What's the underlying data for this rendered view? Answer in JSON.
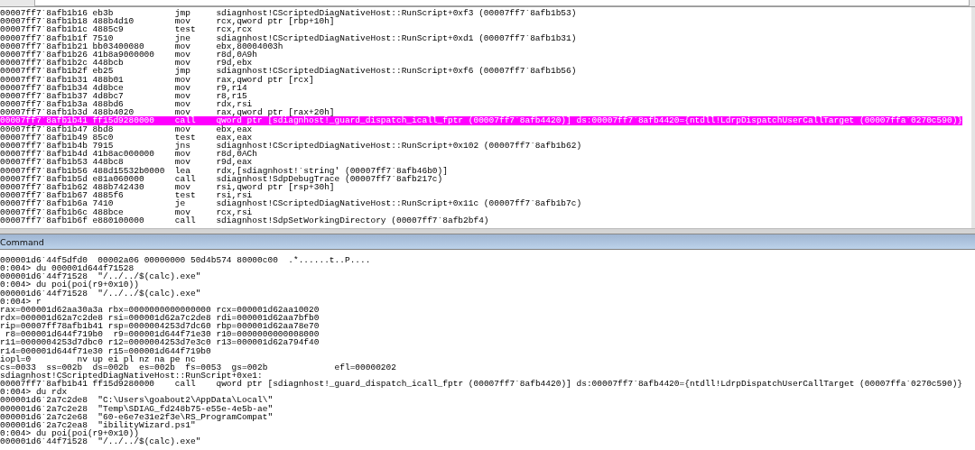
{
  "disassembly": {
    "rows": [
      {
        "address": "00007ff7`8afb1b16",
        "bytes": "eb3b",
        "mnemonic": "jmp",
        "operands": "sdiagnhost!CScriptedDiagNativeHost::RunScript+0xf3 (00007ff7`8afb1b53)",
        "selected": false
      },
      {
        "address": "00007ff7`8afb1b18",
        "bytes": "488b4d10",
        "mnemonic": "mov",
        "operands": "rcx,qword ptr [rbp+10h]",
        "selected": false
      },
      {
        "address": "00007ff7`8afb1b1c",
        "bytes": "4885c9",
        "mnemonic": "test",
        "operands": "rcx,rcx",
        "selected": false
      },
      {
        "address": "00007ff7`8afb1b1f",
        "bytes": "7510",
        "mnemonic": "jne",
        "operands": "sdiagnhost!CScriptedDiagNativeHost::RunScript+0xd1 (00007ff7`8afb1b31)",
        "selected": false
      },
      {
        "address": "00007ff7`8afb1b21",
        "bytes": "bb03400080",
        "mnemonic": "mov",
        "operands": "ebx,80004003h",
        "selected": false
      },
      {
        "address": "00007ff7`8afb1b26",
        "bytes": "41b8a9000000",
        "mnemonic": "mov",
        "operands": "r8d,0A9h",
        "selected": false
      },
      {
        "address": "00007ff7`8afb1b2c",
        "bytes": "448bcb",
        "mnemonic": "mov",
        "operands": "r9d,ebx",
        "selected": false
      },
      {
        "address": "00007ff7`8afb1b2f",
        "bytes": "eb25",
        "mnemonic": "jmp",
        "operands": "sdiagnhost!CScriptedDiagNativeHost::RunScript+0xf6 (00007ff7`8afb1b56)",
        "selected": false
      },
      {
        "address": "00007ff7`8afb1b31",
        "bytes": "488b01",
        "mnemonic": "mov",
        "operands": "rax,qword ptr [rcx]",
        "selected": false
      },
      {
        "address": "00007ff7`8afb1b34",
        "bytes": "4d8bce",
        "mnemonic": "mov",
        "operands": "r9,r14",
        "selected": false
      },
      {
        "address": "00007ff7`8afb1b37",
        "bytes": "4d8bc7",
        "mnemonic": "mov",
        "operands": "r8,r15",
        "selected": false
      },
      {
        "address": "00007ff7`8afb1b3a",
        "bytes": "488bd6",
        "mnemonic": "mov",
        "operands": "rdx,rsi",
        "selected": false
      },
      {
        "address": "00007ff7`8afb1b3d",
        "bytes": "488b4020",
        "mnemonic": "mov",
        "operands": "rax,qword ptr [rax+20h]",
        "selected": false
      },
      {
        "address": "00007ff7`8afb1b41",
        "bytes": "ff15d9280000",
        "mnemonic": "call",
        "operands": "qword ptr [sdiagnhost!_guard_dispatch_icall_fptr (00007ff7`8afb4420)] ds:00007ff7`8afb4420={ntdll!LdrpDispatchUserCallTarget (00007ffa`0270c590)}",
        "selected": true
      },
      {
        "address": "00007ff7`8afb1b47",
        "bytes": "8bd8",
        "mnemonic": "mov",
        "operands": "ebx,eax",
        "selected": false
      },
      {
        "address": "00007ff7`8afb1b49",
        "bytes": "85c0",
        "mnemonic": "test",
        "operands": "eax,eax",
        "selected": false
      },
      {
        "address": "00007ff7`8afb1b4b",
        "bytes": "7915",
        "mnemonic": "jns",
        "operands": "sdiagnhost!CScriptedDiagNativeHost::RunScript+0x102 (00007ff7`8afb1b62)",
        "selected": false
      },
      {
        "address": "00007ff7`8afb1b4d",
        "bytes": "41b8ac000000",
        "mnemonic": "mov",
        "operands": "r8d,0ACh",
        "selected": false
      },
      {
        "address": "00007ff7`8afb1b53",
        "bytes": "448bc8",
        "mnemonic": "mov",
        "operands": "r9d,eax",
        "selected": false
      },
      {
        "address": "00007ff7`8afb1b56",
        "bytes": "488d15532b0000",
        "mnemonic": "lea",
        "operands": "rdx,[sdiagnhost!`string' (00007ff7`8afb46b0)]",
        "selected": false
      },
      {
        "address": "00007ff7`8afb1b5d",
        "bytes": "e81a060000",
        "mnemonic": "call",
        "operands": "sdiagnhost!SdpDebugTrace (00007ff7`8afb217c)",
        "selected": false
      },
      {
        "address": "00007ff7`8afb1b62",
        "bytes": "488b742430",
        "mnemonic": "mov",
        "operands": "rsi,qword ptr [rsp+30h]",
        "selected": false
      },
      {
        "address": "00007ff7`8afb1b67",
        "bytes": "4885f6",
        "mnemonic": "test",
        "operands": "rsi,rsi",
        "selected": false
      },
      {
        "address": "00007ff7`8afb1b6a",
        "bytes": "7410",
        "mnemonic": "je",
        "operands": "sdiagnhost!CScriptedDiagNativeHost::RunScript+0x11c (00007ff7`8afb1b7c)",
        "selected": false
      },
      {
        "address": "00007ff7`8afb1b6c",
        "bytes": "488bce",
        "mnemonic": "mov",
        "operands": "rcx,rsi",
        "selected": false
      },
      {
        "address": "00007ff7`8afb1b6f",
        "bytes": "e880100000",
        "mnemonic": "call",
        "operands": "sdiagnhost!SdpSetWorkingDirectory (00007ff7`8afb2bf4)",
        "selected": false
      }
    ]
  },
  "command": {
    "title": "Command",
    "lines": [
      "000001d6`44f5dfd0  00002a06 00000000 50d4b574 80000c00  .*......t..P....",
      "0:004> du 000001d644f71528",
      "000001d6`44f71528  \"/../../$(calc).exe\"",
      "0:004> du poi(poi(r9+0x10))",
      "000001d6`44f71528  \"/../../$(calc).exe\"",
      "0:004> r",
      "rax=000001d62aa30a3a rbx=0000000000000000 rcx=000001d62aa10020",
      "rdx=000001d62a7c2de8 rsi=000001d62a7c2de8 rdi=000001d62aa7bfb0",
      "rip=00007ff78afb1b41 rsp=0000004253d7dc60 rbp=000001d62aa78e70",
      " r8=000001d644f719b0  r9=000001d644f71e30 r10=0000000000008000",
      "r11=0000004253d7dbc0 r12=0000004253d7e3c0 r13=000001d62a794f40",
      "r14=000001d644f71e30 r15=000001d644f719b0",
      "iopl=0         nv up ei pl nz na pe nc",
      "cs=0033  ss=002b  ds=002b  es=002b  fs=0053  gs=002b             efl=00000202",
      "sdiagnhost!CScriptedDiagNativeHost::RunScript+0xe1:",
      "00007ff7`8afb1b41 ff15d9280000    call    qword ptr [sdiagnhost!_guard_dispatch_icall_fptr (00007ff7`8afb4420)] ds:00007ff7`8afb4420={ntdll!LdrpDispatchUserCallTarget (00007ffa`0270c590)}",
      "0:004> du rdx",
      "000001d6`2a7c2de8  \"C:\\Users\\goabout2\\AppData\\Local\\\"",
      "000001d6`2a7c2e28  \"Temp\\SDIAG_fd248b75-e55e-4e5b-ae\"",
      "000001d6`2a7c2e68  \"60-e6e7e31e2f3e\\RS_ProgramCompat\"",
      "000001d6`2a7c2ea8  \"ibilityWizard.ps1\"",
      "0:004> du poi(poi(r9+0x10))",
      "000001d6`44f71528  \"/../../$(calc).exe\""
    ]
  }
}
